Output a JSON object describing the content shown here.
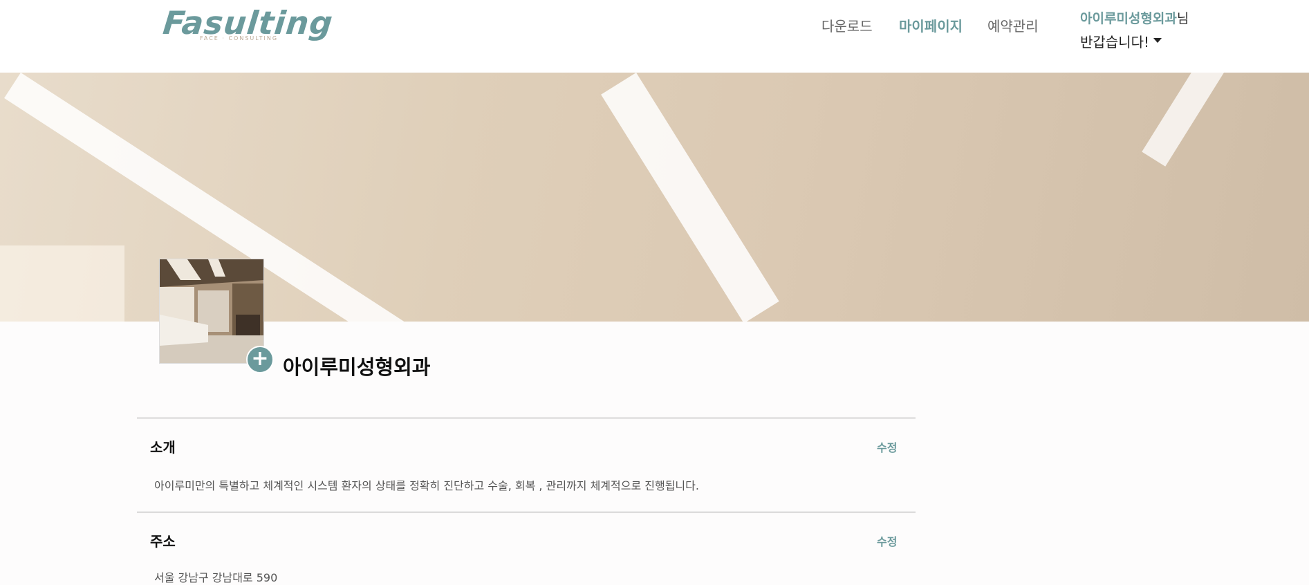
{
  "logo": {
    "word": "Fasulting",
    "tagline": "FACE · CONSULTING"
  },
  "nav": {
    "download": "다운로드",
    "mypage": "마이페이지",
    "reservation": "예약관리"
  },
  "user": {
    "name": "아이루미성형외과",
    "suffix": "님",
    "greeting": "반갑습니다!"
  },
  "profile": {
    "clinic_name": "아이루미성형외과",
    "add_icon": "plus-circle-icon",
    "add_symbol": "+"
  },
  "sections": {
    "intro": {
      "title": "소개",
      "edit": "수정",
      "text": "아이루미만의 특별하고 체계적인 시스템 환자의 상태를 정확히 진단하고 수술, 회복 , 관리까지 체계적으로 진행됩니다."
    },
    "address": {
      "title": "주소",
      "edit": "수정",
      "text": "서울 강남구 강남대로 590"
    }
  },
  "colors": {
    "accent": "#6b9a9c",
    "logo_sub": "#bba995",
    "text": "#222222"
  }
}
